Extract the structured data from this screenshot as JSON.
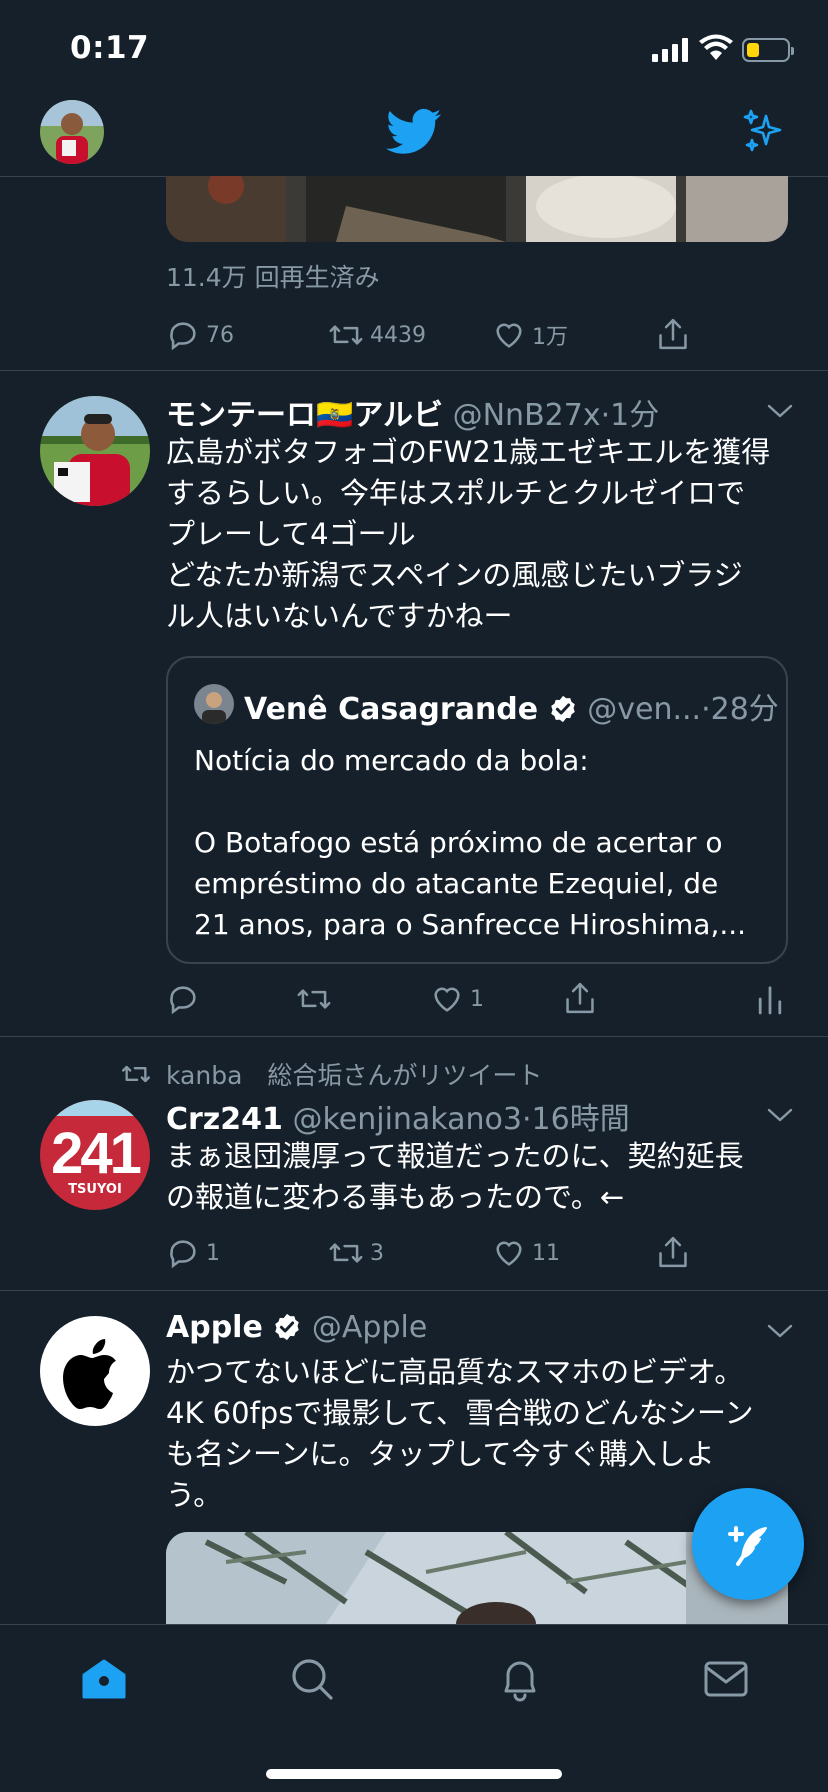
{
  "status_bar": {
    "time": "0:17",
    "battery_color": "#ffd60a"
  },
  "colors": {
    "background": "#15202b",
    "accent": "#1da1f2",
    "muted": "#8899a6",
    "divider": "#38444d"
  },
  "header": {
    "logo_icon": "twitter-bird-icon",
    "sparkle_icon": "sparkle-icon"
  },
  "tweet0": {
    "view_count": "11.4万 回再生済み",
    "replies": "76",
    "retweets": "4439",
    "likes": "1万"
  },
  "tweet1": {
    "display_name": "モンテーロ🇪🇨アルビ",
    "handle": "@NnB27x",
    "time": "·1分",
    "text": "広島がボタフォゴのFW21歳エゼキエルを獲得\nするらしい。今年はスポルチとクルゼイロで\nプレーして4ゴール\nどなたか新潟でスペインの風感じたいブラジ\nル人はいないんですかねー",
    "quote": {
      "display_name": "Venê Casagrande",
      "handle": "@ven...",
      "time": "·28分",
      "text": "Notícia do mercado da bola:\n\nO Botafogo está próximo de acertar o\nempréstimo do atacante Ezequiel, de\n21 anos, para o Sanfrecce Hiroshima,..."
    },
    "likes": "1"
  },
  "tweet2": {
    "retweet_by": "kanba　総合垢さんがリツイート",
    "display_name": "Crz241",
    "handle": "@kenjinakano3",
    "time": "·16時間",
    "text": "まぁ退団濃厚って報道だったのに、契約延長\nの報道に変わる事もあったので。←",
    "avatar_number": "241",
    "avatar_caption": "TSUYOI",
    "replies": "1",
    "retweets": "3",
    "likes": "11"
  },
  "tweet3": {
    "display_name": "Apple",
    "handle": "@Apple",
    "text": "かつてないほどに高品質なスマホのビデオ。\n4K 60fpsで撮影して、雪合戦のどんなシーン\nも名シーンに。タップして今すぐ購入しよ\nう。"
  },
  "bottom_nav": {
    "items": [
      "home-icon",
      "search-icon",
      "notifications-icon",
      "messages-icon"
    ],
    "active": "home-icon"
  }
}
